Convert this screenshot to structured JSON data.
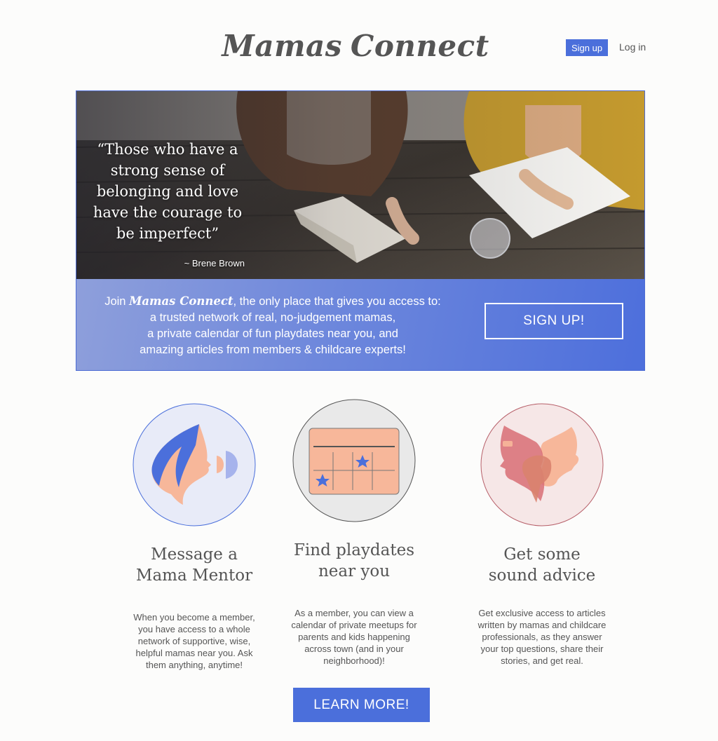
{
  "brand": {
    "word_left": "Mamas",
    "word_right": "Connect",
    "logo_icon": "butterfly-silhouettes-icon"
  },
  "nav": {
    "signup_label": "Sign up",
    "login_label": "Log in"
  },
  "hero": {
    "quote": "“Those who have a strong sense of belonging and love have the courage to be imperfect”",
    "author": "~ Brene Brown",
    "band": {
      "prefix": "Join ",
      "brand": "Mamas Connect",
      "suffix": ", the only place that gives you access to:",
      "line2": "a trusted network of real, no-judgement mamas,",
      "line3": "a private calendar of fun playdates near you, and",
      "line4": "amazing articles from members  & childcare experts!"
    },
    "cta_label": "SIGN UP!"
  },
  "features": [
    {
      "icon": "speaking-mama-icon",
      "title_line1": "Message a",
      "title_line2": "Mama Mentor",
      "body": "When you become a member, you have access to a whole network of supportive, wise, helpful mamas near you. Ask them anything, anytime!"
    },
    {
      "icon": "calendar-icon",
      "title_line1": "Find playdates",
      "title_line2": "near you",
      "body": "As a member, you can view a calendar of private meetups for parents and kids happening across town (and in your neighborhood)!"
    },
    {
      "icon": "two-mamas-icon",
      "title_line1": "Get some",
      "title_line2": "sound advice",
      "body": "Get exclusive access to articles written by mamas and childcare professionals, as they answer your top questions, share their stories, and get real."
    }
  ],
  "learn_more_label": "LEARN MORE!",
  "colors": {
    "accent": "#4b6fdb",
    "peach": "#f7b79a",
    "text": "#555555"
  }
}
